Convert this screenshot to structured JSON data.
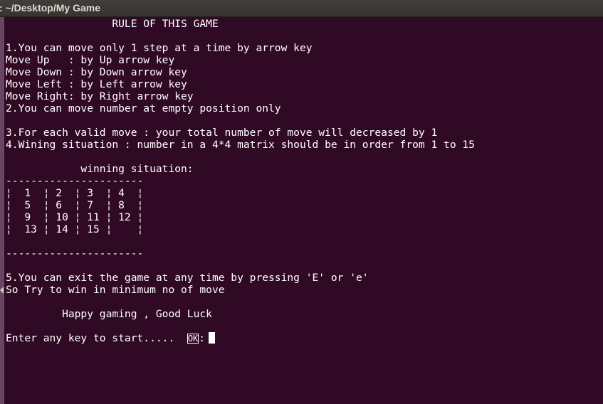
{
  "window": {
    "title": ": ~/Desktop/My Game"
  },
  "terminal": {
    "lines": [
      "                 RULE OF THIS GAME",
      "",
      "1.You can move only 1 step at a time by arrow key",
      "Move Up   : by Up arrow key",
      "Move Down : by Down arrow key",
      "Move Left : by Left arrow key",
      "Move Right: by Right arrow key",
      "2.You can move number at empty position only",
      "",
      "3.For each valid move : your total number of move will decreased by 1",
      "4.Wining situation : number in a 4*4 matrix should be in order from 1 to 15",
      "",
      "            winning situation:",
      "----------------------",
      "¦  1  ¦ 2  ¦ 3  ¦ 4  ¦",
      "¦  5  ¦ 6  ¦ 7  ¦ 8  ¦",
      "¦  9  ¦ 10 ¦ 11 ¦ 12 ¦",
      "¦  13 ¦ 14 ¦ 15 ¦    ¦",
      "",
      "----------------------",
      "",
      "5.You can exit the game at any time by pressing 'E' or 'e'",
      "So Try to win in minimum no of move",
      "",
      "         Happy gaming , Good Luck",
      ""
    ],
    "prompt": {
      "text": "Enter any key to start.....  ",
      "ok_label": "OK",
      "suffix": ":"
    }
  },
  "colors": {
    "background": "#300a24",
    "text": "#ffffff",
    "titlebar": "#3c3b37"
  }
}
